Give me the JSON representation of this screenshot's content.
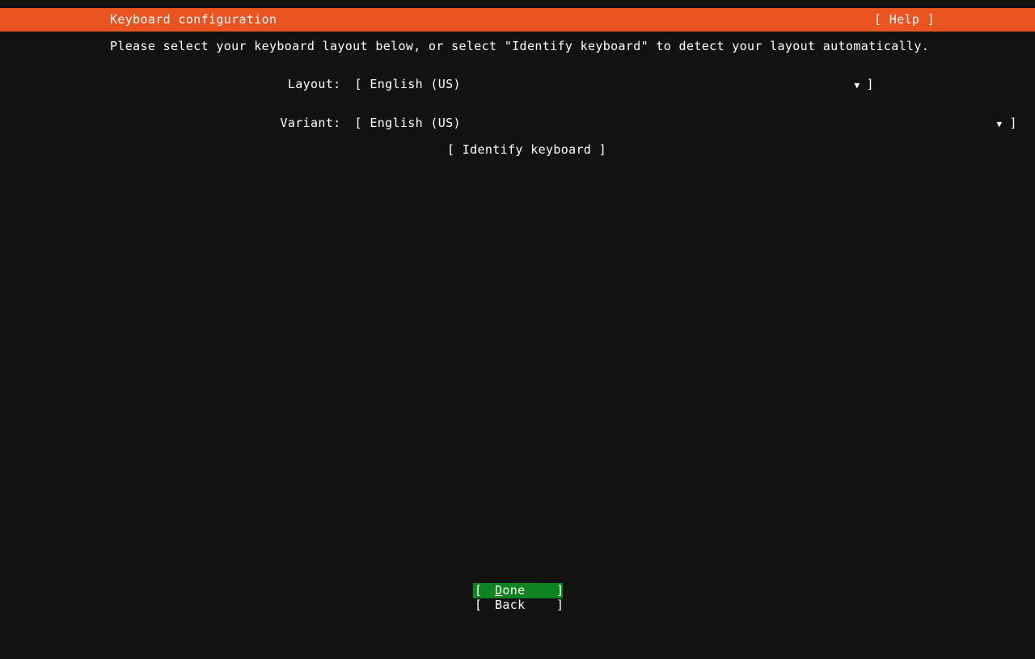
{
  "header": {
    "title": "Keyboard configuration",
    "help_label": "[ Help ]",
    "bg_color": "#e95420",
    "fg_color": "#ffffff"
  },
  "main": {
    "instruction": "Please select your keyboard layout below, or select \"Identify keyboard\" to detect your layout automatically.",
    "fields": [
      {
        "label": "Layout:",
        "value": "English (US)",
        "open_bracket": "[",
        "close_bracket": "]",
        "arrow": "▼"
      },
      {
        "label": "Variant:",
        "value": "English (US)",
        "open_bracket": "[",
        "close_bracket": "]",
        "arrow": "▼"
      }
    ],
    "identify_button": "[ Identify keyboard ]"
  },
  "footer": {
    "buttons": [
      {
        "open_bracket": "[",
        "accel": "D",
        "rest": "one",
        "close_bracket": "]",
        "selected": true,
        "highlight_color": "#0e8420"
      },
      {
        "open_bracket": "[",
        "accel": "",
        "rest": "Back",
        "close_bracket": "]",
        "selected": false,
        "highlight_color": ""
      }
    ]
  },
  "colors": {
    "background": "#121212",
    "foreground": "#ffffff",
    "accent_orange": "#e95420",
    "accent_green": "#0e8420"
  }
}
